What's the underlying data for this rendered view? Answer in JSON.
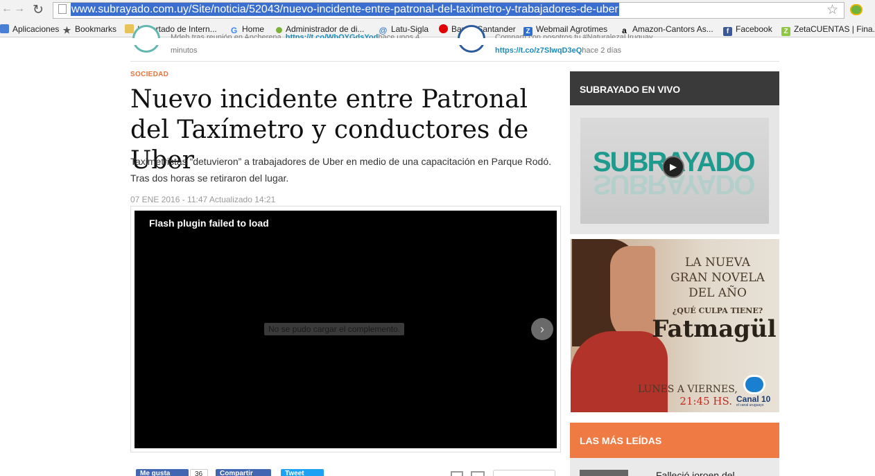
{
  "browser": {
    "url": "www.subrayado.com.uy/Site/noticia/52043/nuevo-incidente-entre-patronal-del-taximetro-y-trabajadores-de-uber",
    "bookmarks": [
      {
        "label": "Aplicaciones",
        "icon": "apps-grid-icon"
      },
      {
        "label": "Bookmarks",
        "icon": "star-icon"
      },
      {
        "label": "Importado de Intern...",
        "icon": "folder-icon"
      },
      {
        "label": "Home",
        "icon": "google-icon"
      },
      {
        "label": "Administrador de di...",
        "icon": "green-dot-icon"
      },
      {
        "label": "Latu-Sigla",
        "icon": "swirl-icon"
      },
      {
        "label": "Banco Santander",
        "icon": "santander-icon"
      },
      {
        "label": "Webmail Agrotimes",
        "icon": "z-icon"
      },
      {
        "label": "Amazon-Cantors As...",
        "icon": "amazon-icon"
      },
      {
        "label": "Facebook",
        "icon": "facebook-icon"
      },
      {
        "label": "ZetaCUENTAS | Fina...",
        "icon": "zeta-icon"
      }
    ]
  },
  "tweets": [
    {
      "text_pre": "Mdeh tras reunión en Ancherena.",
      "link": "https://t.co/WbOYGdsYod",
      "time": "hace unos 4",
      "cont": "minutos"
    },
    {
      "text_pre": "Compartí con nosotros tu #NaturalezaUruguay.",
      "link": "https://t.co/z7SlwqD3eQ",
      "time": "hace 2 días"
    }
  ],
  "article": {
    "category": "SOCIEDAD",
    "headline": "Nuevo incidente entre Patronal del Taxímetro y conductores de Uber",
    "lead": "Taximetristas “detuvieron” a trabajadores de Uber en medio de una capacitación en Parque Rodó. Tras dos horas se retiraron del lugar.",
    "date": "07 ENE 2016 - 11:47 Actualizado 14:21",
    "video": {
      "flash_error": "Flash plugin failed to load",
      "plugin_error": "No se pudo cargar el complemento."
    },
    "share": {
      "like": "Me gusta",
      "like_count": "36",
      "share": "Compartir",
      "tweet": "Tweet"
    }
  },
  "sidebar": {
    "live_title": "SUBRAYADO EN VIVO",
    "live_logo": "SUBRAYADO",
    "ad": {
      "line1": "LA NUEVA",
      "line2": "GRAN NOVELA",
      "line3": "DEL AÑO",
      "question": "¿QUÉ CULPA TIENE?",
      "show": "Fatmagül",
      "days": "LUNES A VIERNES,",
      "time": "21:45 HS.",
      "channel": "Canal 10",
      "channel_sub": "el canal uruguayo"
    },
    "most_read_title": "LAS MÁS LEÍDAS",
    "most_read_first": "Falleció joroen del"
  },
  "colors": {
    "accent": "#f07a43",
    "link": "#1a8cbc",
    "dark_header": "#3a3a3a"
  }
}
